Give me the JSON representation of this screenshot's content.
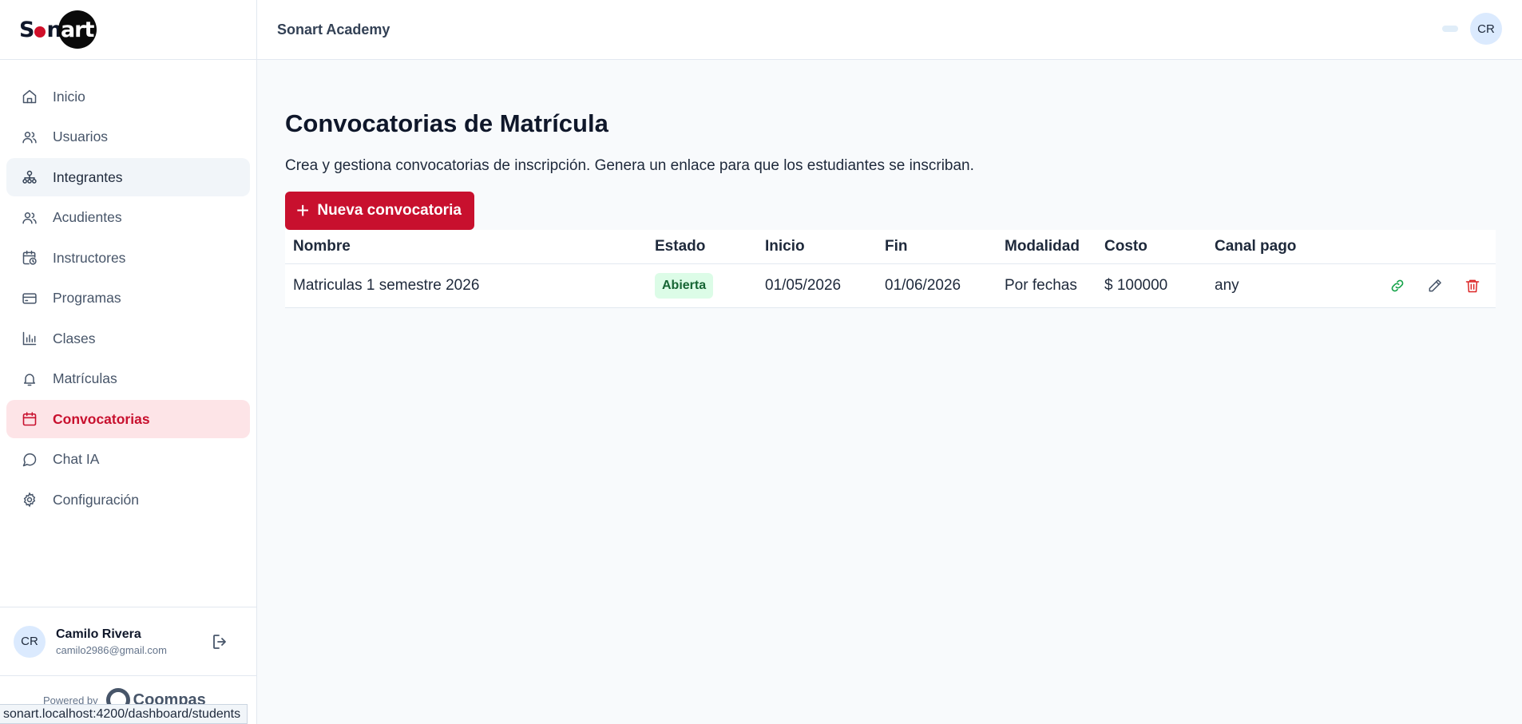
{
  "app": {
    "logo_text_start": "S",
    "logo_text_mid": "n",
    "logo_text_end": "art",
    "academy_name": "Sonart Academy",
    "user_initials": "CR"
  },
  "sidebar": {
    "items": [
      {
        "label": "Inicio",
        "icon": "home-icon"
      },
      {
        "label": "Usuarios",
        "icon": "users-icon"
      },
      {
        "label": "Integrantes",
        "icon": "sitemap-icon"
      },
      {
        "label": "Acudientes",
        "icon": "users-icon"
      },
      {
        "label": "Instructores",
        "icon": "calendar-clock-icon"
      },
      {
        "label": "Programas",
        "icon": "credit-card-icon"
      },
      {
        "label": "Clases",
        "icon": "bar-chart-icon"
      },
      {
        "label": "Matrículas",
        "icon": "bell-icon"
      },
      {
        "label": "Convocatorias",
        "icon": "calendar-icon"
      },
      {
        "label": "Chat IA",
        "icon": "message-circle-icon"
      },
      {
        "label": "Configuración",
        "icon": "settings-icon"
      }
    ],
    "user": {
      "initials": "CR",
      "name": "Camilo Rivera",
      "email": "camilo2986@gmail.com"
    },
    "powered_by": "Powered by",
    "powered_brand": "Coompas"
  },
  "status_bar_url": "sonart.localhost:4200/dashboard/students",
  "main": {
    "title": "Convocatorias de Matrícula",
    "subtitle": "Crea y gestiona convocatorias de inscripción. Genera un enlace para que los estudiantes se inscriban.",
    "new_button": "Nueva convocatoria",
    "table": {
      "headers": [
        "Nombre",
        "Estado",
        "Inicio",
        "Fin",
        "Modalidad",
        "Costo",
        "Canal pago"
      ],
      "rows": [
        [
          "Matriculas 1 semestre 2026",
          "Abierta",
          "01/05/2026",
          "01/06/2026",
          "Por fechas",
          "$ 100000",
          "any"
        ]
      ]
    }
  },
  "colors": {
    "brand_red": "#c8102e",
    "active_bg": "#fde4e7",
    "badge_bg": "#dcfce7",
    "badge_text": "#166534",
    "link_icon": "#16a34a",
    "delete_icon": "#dc2626"
  }
}
